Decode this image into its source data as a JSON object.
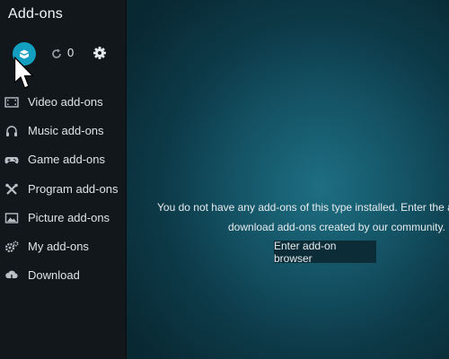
{
  "header": {
    "title": "Add-ons"
  },
  "toolbar": {
    "install_icon": "open-box-icon",
    "update_icon": "refresh-icon",
    "update_count": "0",
    "settings_icon": "gear-icon",
    "accent_color": "#139fbf"
  },
  "sidebar": {
    "items": [
      {
        "label": "Video add-ons",
        "icon": "film-icon"
      },
      {
        "label": "Music add-ons",
        "icon": "headphones-icon"
      },
      {
        "label": "Game add-ons",
        "icon": "gamepad-icon"
      },
      {
        "label": "Program add-ons",
        "icon": "tools-icon"
      },
      {
        "label": "Picture add-ons",
        "icon": "picture-icon"
      },
      {
        "label": "My add-ons",
        "icon": "gears-icon"
      },
      {
        "label": "Download",
        "icon": "cloud-download-icon"
      }
    ]
  },
  "main": {
    "message_line1": "You do not have any add-ons of this type installed. Enter the add-on b",
    "message_line2": "download add-ons created by our community.",
    "browser_button": "Enter add-on browser"
  }
}
